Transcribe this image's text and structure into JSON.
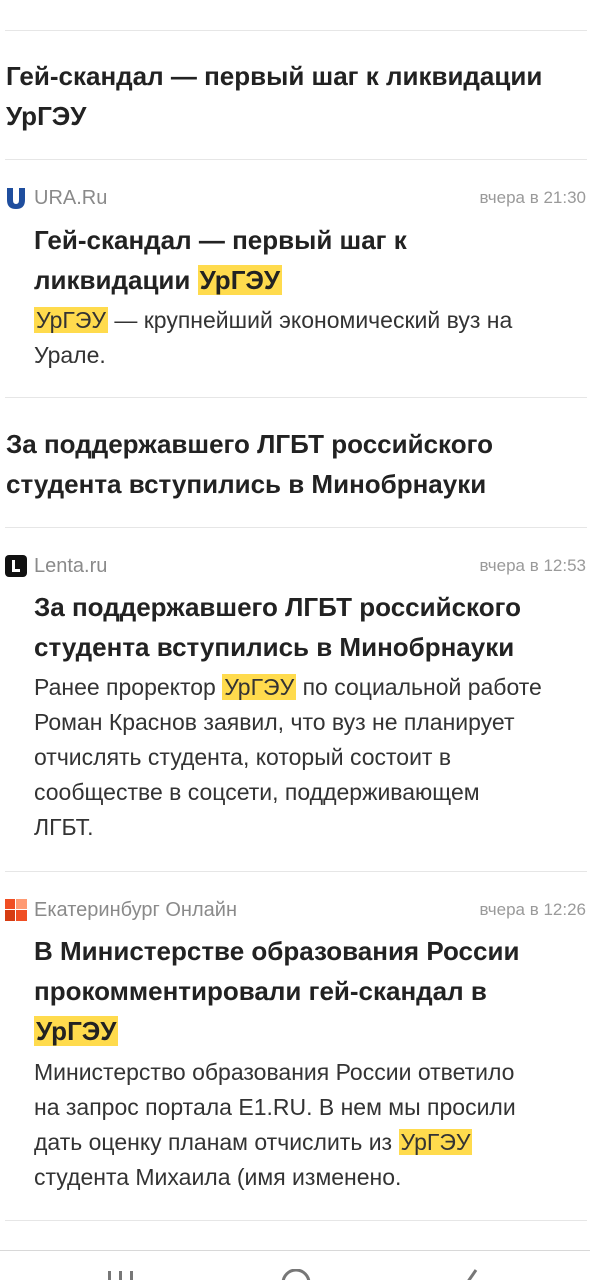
{
  "topics": [
    {
      "title": "Гей-скандал — первый шаг к ликвидации УрГЭУ"
    },
    {
      "title": "За поддержавшего ЛГБТ российского студента вступились в Минобрнауки"
    }
  ],
  "articles": [
    {
      "source": "URA.Ru",
      "time": "вчера в 21:30",
      "title_a": "Гей-скандал — первый шаг к",
      "title_b": "ликвидации ",
      "title_hl": "УрГЭУ",
      "snippet_hl": "УрГЭУ",
      "snippet_a": " — крупнейший экономический вуз на",
      "snippet_b": "Урале."
    },
    {
      "source": "Lenta.ru",
      "time": "вчера в 12:53",
      "title_a": "За поддержавшего ЛГБТ российского",
      "title_b": "студента вступились в Минобрнауки",
      "snippet_a": "Ранее проректор ",
      "snippet_hl": "УрГЭУ",
      "snippet_a2": " по социальной работе",
      "snippet_b": "Роман Краснов заявил, что вуз не планирует",
      "snippet_c": "отчислять студента, который состоит в",
      "snippet_d": "сообществе в соцсети, поддерживающем",
      "snippet_e": "ЛГБТ."
    },
    {
      "source": "Екатеринбург Онлайн",
      "time": "вчера в 12:26",
      "title_a": "В Министерстве образования России",
      "title_b": "прокомментировали гей-скандал в",
      "title_hl": "УрГЭУ",
      "snippet_a": "Министерство образования России ответило",
      "snippet_b": "на запрос портала E1.RU. В нем мы просили",
      "snippet_c": "дать оценку планам отчислить из ",
      "snippet_hl": "УрГЭУ",
      "snippet_d": "студента Михаила (имя изменено."
    }
  ],
  "colors": {
    "highlight": "#ffdb4d",
    "ura_brand": "#1f4e9e",
    "e1_brand": "#f04e23"
  }
}
